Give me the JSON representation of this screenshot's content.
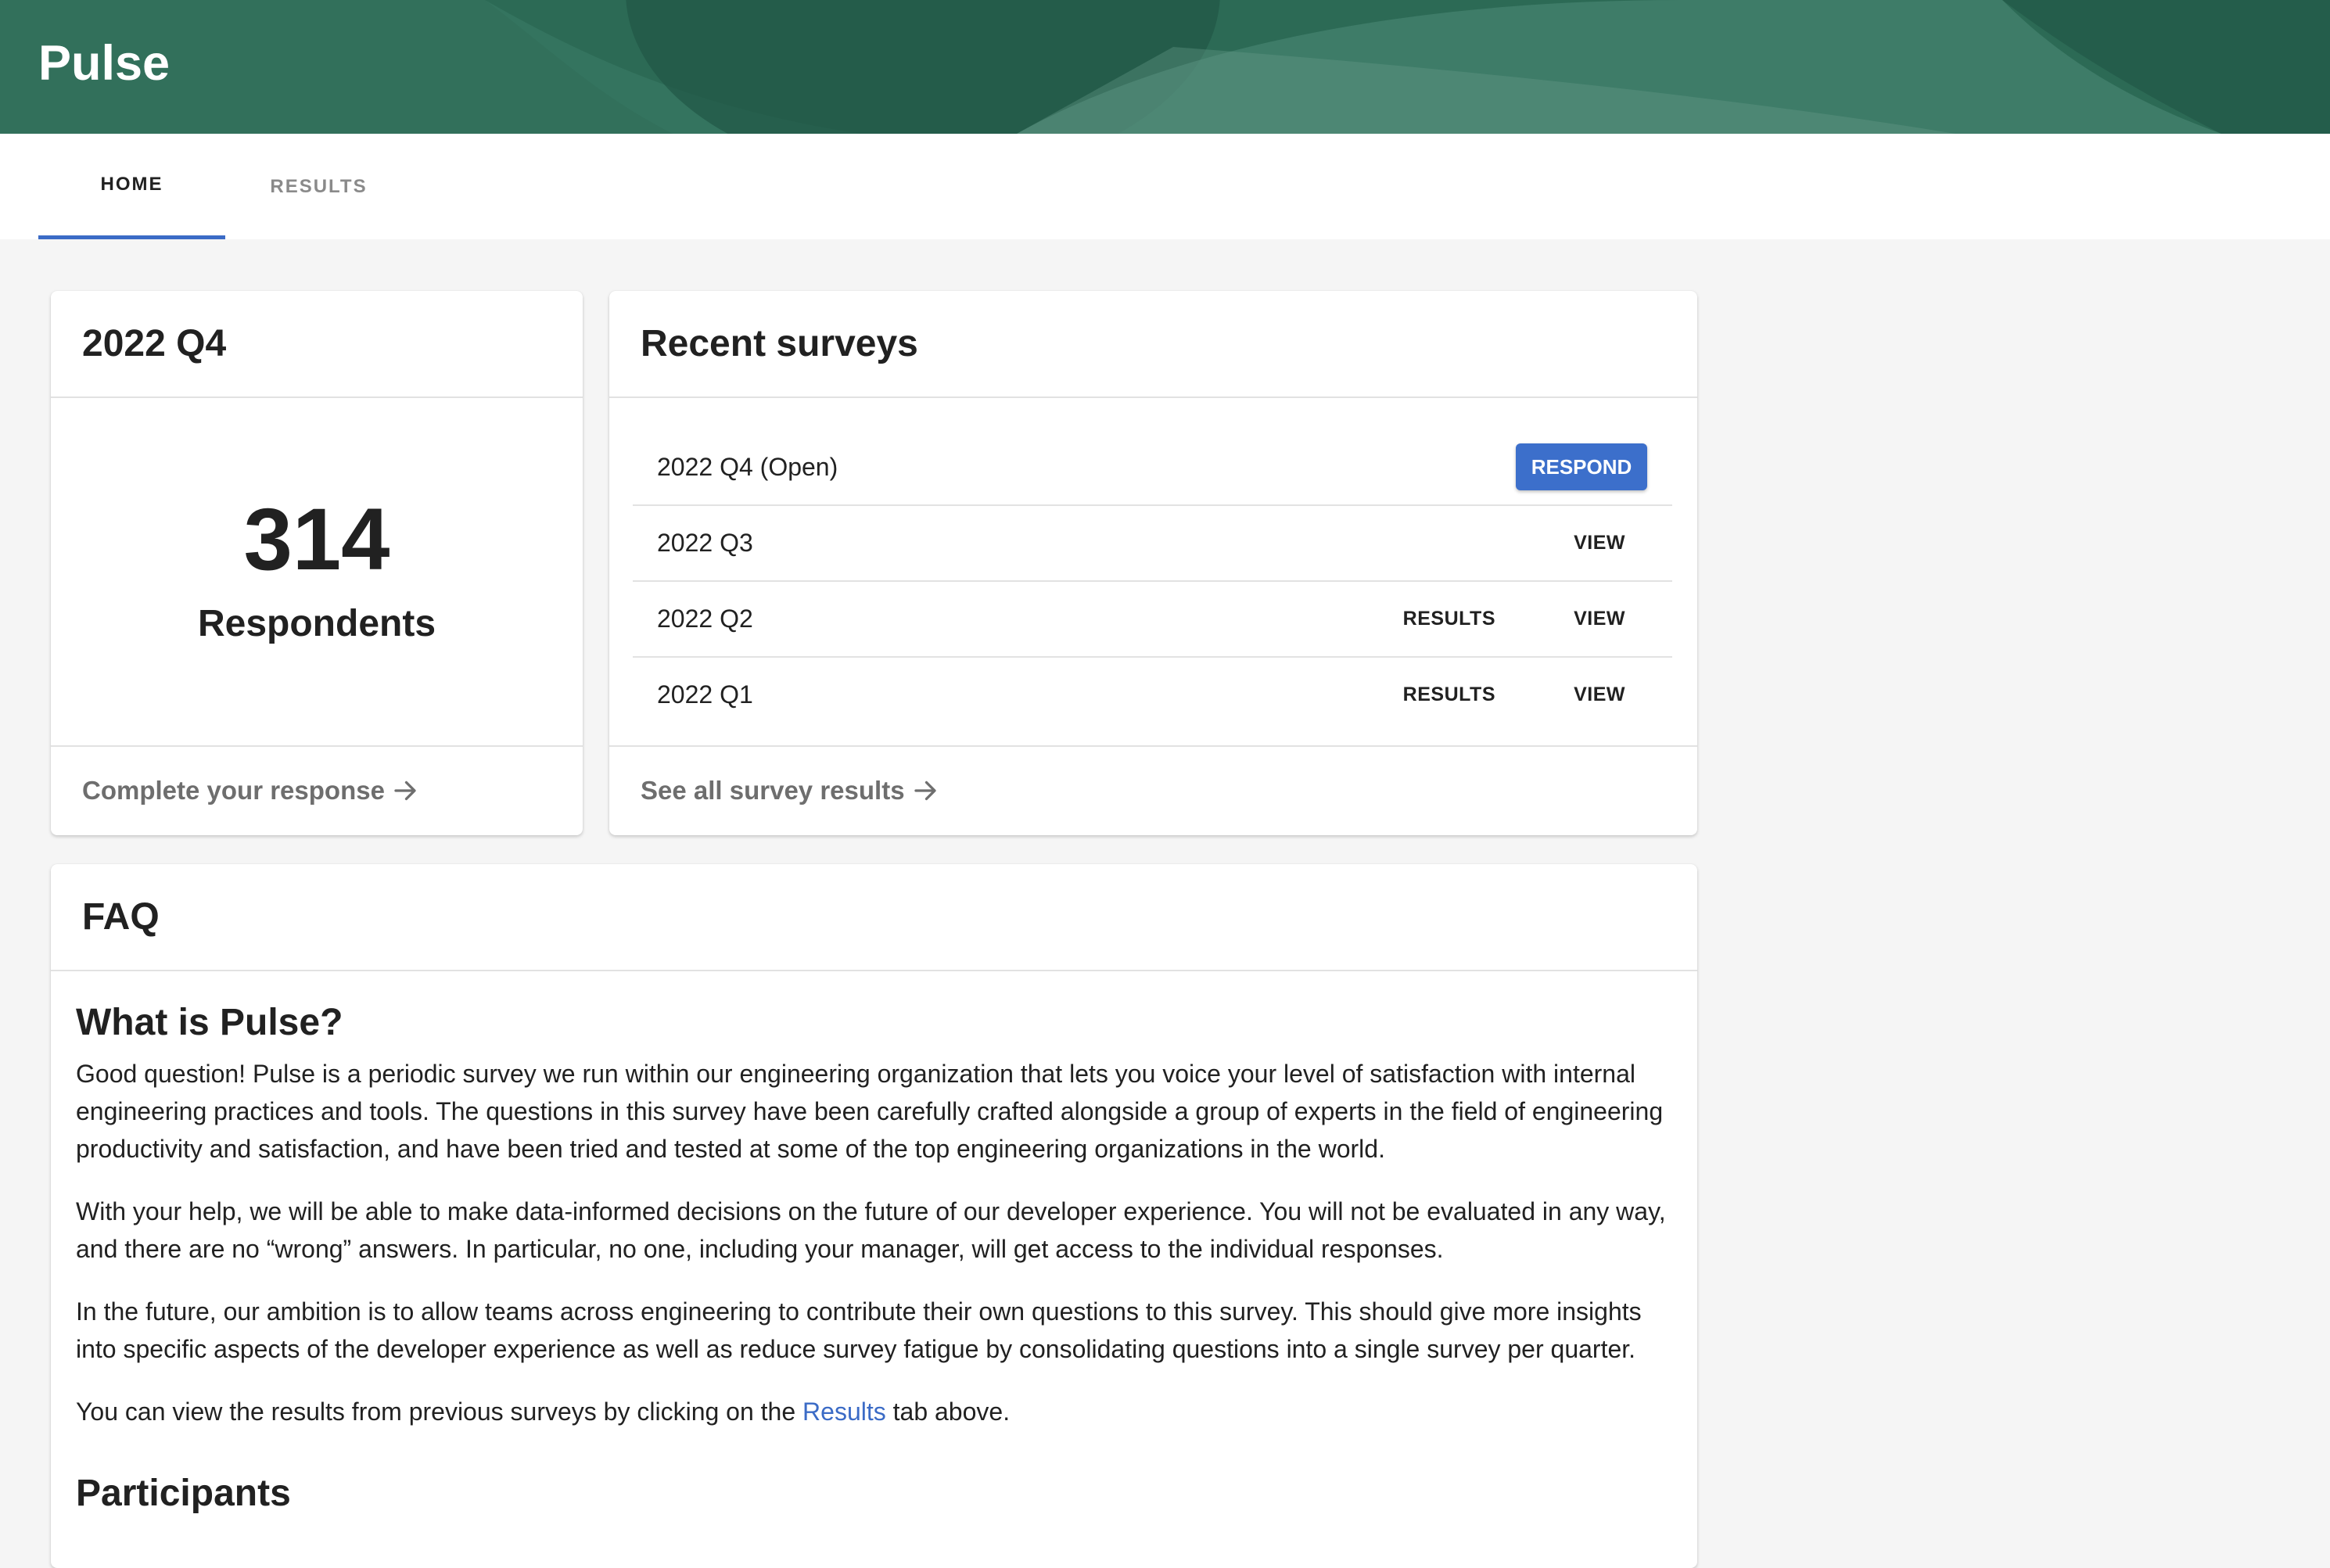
{
  "app": {
    "title": "Pulse",
    "accent": "#3b6bc6",
    "header_color": "#2c6a55"
  },
  "tabs": [
    {
      "label": "HOME",
      "active": true
    },
    {
      "label": "RESULTS",
      "active": false
    }
  ],
  "current_survey": {
    "title": "2022 Q4",
    "respondents_count": "314",
    "respondents_label": "Respondents",
    "footer_link": "Complete your response",
    "footer_icon": "arrow-right-icon"
  },
  "recent_surveys": {
    "title": "Recent surveys",
    "rows": [
      {
        "name": "2022 Q4 (Open)",
        "primary_action": "RESPOND"
      },
      {
        "name": "2022 Q3",
        "view_action": "VIEW"
      },
      {
        "name": "2022 Q2",
        "results_action": "RESULTS",
        "view_action": "VIEW"
      },
      {
        "name": "2022 Q1",
        "results_action": "RESULTS",
        "view_action": "VIEW"
      }
    ],
    "footer_link": "See all survey results",
    "footer_icon": "arrow-right-icon"
  },
  "faq": {
    "title": "FAQ",
    "what_heading": "What is Pulse?",
    "p1": "Good question! Pulse is a periodic survey we run within our engineering organization that lets you voice your level of satisfaction with internal engineering practices and tools. The questions in this survey have been carefully crafted alongside a group of experts in the field of engineering productivity and satisfaction, and have been tried and tested at some of the top engineering organizations in the world.",
    "p2": "With your help, we will be able to make data-informed decisions on the future of our developer experience. You will not be evaluated in any way, and there are no “wrong” answers. In particular, no one, including your manager, will get access to the individual responses.",
    "p3": "In the future, our ambition is to allow teams across engineering to contribute their own questions to this survey. This should give more insights into specific aspects of the developer experience as well as reduce survey fatigue by consolidating questions into a single survey per quarter.",
    "p4_before": "You can view the results from previous surveys by clicking on the ",
    "p4_link": "Results",
    "p4_after": " tab above.",
    "participants_heading": "Participants"
  }
}
